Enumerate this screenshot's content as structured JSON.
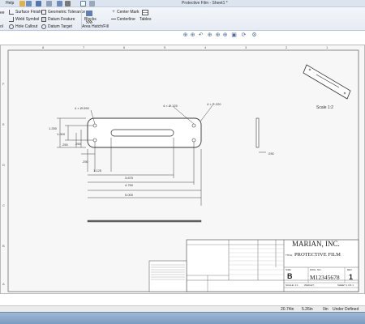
{
  "app": {
    "quick_access": {
      "help_label": "Help"
    },
    "document_title": "Protective Film - Sheet1 *"
  },
  "ribbon": {
    "annotation": {
      "surface_finish": "Surface Finish",
      "weld_symbol": "Weld Symbol",
      "hole_callout": "Hole Callout",
      "geometric_tolerance": "Geometric Tolerance",
      "datum_feature": "Datum Feature",
      "datum_target": "Datum Target",
      "blocks": "Blocks",
      "area_hatch_fill": "Area Hatch/Fill",
      "center_mark": "Center Mark",
      "centerline": "Centerline",
      "tables": "Tables",
      "cut_labels": {
        "ee": "ee",
        "ol": "ol"
      }
    }
  },
  "sheet": {
    "zone_numbers_top": [
      "8",
      "7",
      "6",
      "5",
      "4",
      "3",
      "2",
      "1"
    ],
    "zone_letters_left": [
      "F",
      "E",
      "D",
      "C",
      "B",
      "A"
    ],
    "isometric_view_label": "Scale 1:2",
    "dimensions": {
      "hole_callout_left": "4 × Ø.090",
      "hole_callout_mid": "4 × Ø.125",
      "radius_callout": "4 × R.220",
      "dim_1_250": "1.250",
      "dim_1_000": "1.000",
      "dim_250_a": ".250",
      "dim_250_b": ".250",
      "dim_250_c": ".250",
      "dim_1_125": "1.125",
      "dim_3_875": "3.875",
      "dim_4_750": "4.750",
      "dim_5_000": "5.000",
      "dim_side": ".030"
    },
    "title_block": {
      "company": "MARIAN, INC.",
      "title_label": "TITLE:",
      "title": "PROTECTIVE FILM",
      "size_label": "SIZE",
      "size": "B",
      "dwg_no_label": "DWG. NO.",
      "dwg_no": "M12345678",
      "rev_label": "REV",
      "rev": "1",
      "scale": "SCALE: 1:1",
      "weight": "WEIGHT:",
      "sheet": "SHEET 1 OF 1"
    }
  },
  "status": {
    "x": "20.74in",
    "y": "5.26in",
    "z": "0in",
    "state": "Under Defined"
  }
}
